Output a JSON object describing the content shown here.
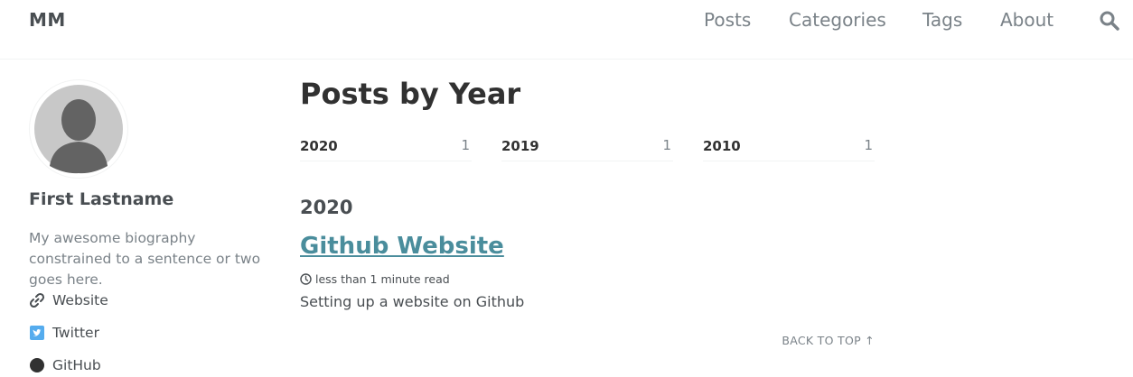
{
  "masthead": {
    "site_title": "MM",
    "nav": [
      "Posts",
      "Categories",
      "Tags",
      "About"
    ]
  },
  "author": {
    "name": "First Lastname",
    "bio": "My awesome biography constrained to a sentence or two goes here.",
    "links": [
      {
        "label": "Website",
        "icon": "link-icon"
      },
      {
        "label": "Twitter",
        "icon": "twitter-icon",
        "color": "#55acee"
      },
      {
        "label": "GitHub",
        "icon": "github-icon"
      }
    ]
  },
  "page": {
    "title": "Posts by Year",
    "years": [
      {
        "year": "2020",
        "count": "1"
      },
      {
        "year": "2019",
        "count": "1"
      },
      {
        "year": "2010",
        "count": "1"
      }
    ],
    "archive_year": "2020",
    "post": {
      "title": "Github Website",
      "read_time": "less than 1 minute read",
      "excerpt": "Setting up a website on Github"
    },
    "back_to_top": "BACK TO TOP ↑"
  },
  "colors": {
    "accent_link": "#4a8d9c",
    "text": "#494e52",
    "muted": "#7a8288"
  }
}
